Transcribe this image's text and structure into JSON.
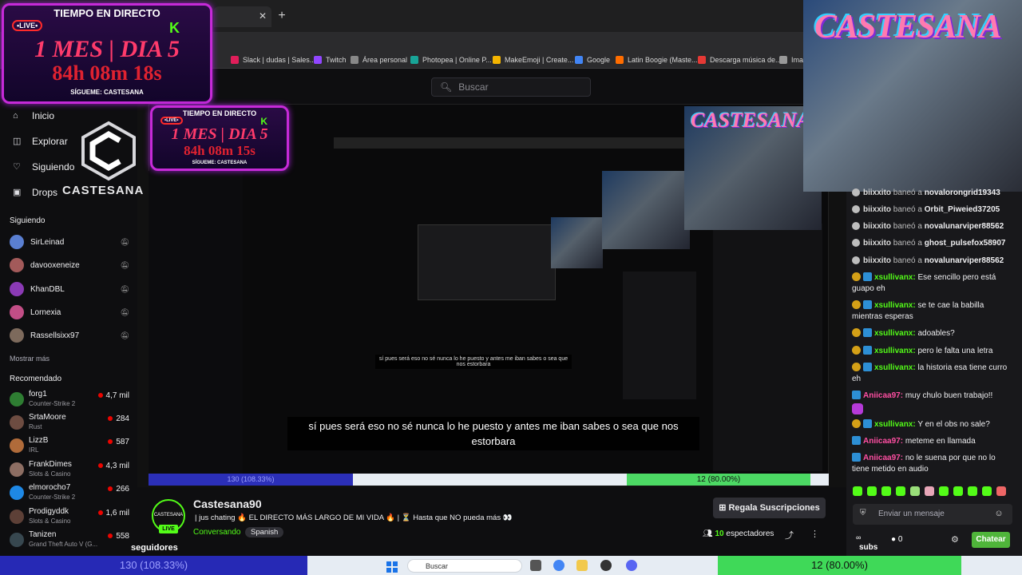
{
  "browser": {
    "bookmarks": [
      {
        "label": "Slack | dudas | Sales...",
        "color": "#e01e5a"
      },
      {
        "label": "Twitch",
        "color": "#9146ff"
      },
      {
        "label": "Área personal",
        "color": "#888888"
      },
      {
        "label": "Photopea | Online P...",
        "color": "#18a497"
      },
      {
        "label": "MakeEmoji | Create...",
        "color": "#f4b400"
      },
      {
        "label": "Google",
        "color": "#4285f4"
      },
      {
        "label": "Latin Boogie (Maste...",
        "color": "#ff6d00"
      },
      {
        "label": "Descarga música de...",
        "color": "#e53935"
      },
      {
        "label": "Imag",
        "color": "#999999"
      }
    ]
  },
  "header": {
    "search_placeholder": "Buscar"
  },
  "sidebar": {
    "nav": [
      {
        "label": "Inicio",
        "icon": "home-icon"
      },
      {
        "label": "Explorar",
        "icon": "explore-icon"
      },
      {
        "label": "Siguiendo",
        "icon": "heart-icon"
      },
      {
        "label": "Drops",
        "icon": "drops-icon"
      }
    ],
    "following_title": "Siguiendo",
    "following": [
      {
        "name": "SirLeinad",
        "color": "#5a7fd1"
      },
      {
        "name": "davooxeneize",
        "color": "#a35a5a"
      },
      {
        "name": "KhanDBL",
        "color": "#8b3ab5"
      },
      {
        "name": "Lornexia",
        "color": "#c24e86"
      },
      {
        "name": "Rassellsixx97",
        "color": "#7d6a5c"
      }
    ],
    "show_more": "Mostrar más",
    "recommended_title": "Recomendado",
    "recommended": [
      {
        "name": "forg1",
        "game": "Counter-Strike 2",
        "viewers": "4,7 mil",
        "color": "#2e7d32"
      },
      {
        "name": "SrtaMoore",
        "game": "Rust",
        "viewers": "284",
        "color": "#6d4c41"
      },
      {
        "name": "LizzB",
        "game": "IRL",
        "viewers": "587",
        "color": "#b06b3a"
      },
      {
        "name": "FrankDimes",
        "game": "Slots & Casino",
        "viewers": "4,3 mil",
        "color": "#8d6e63"
      },
      {
        "name": "elmorocho7",
        "game": "Counter-Strike 2",
        "viewers": "266",
        "color": "#1e88e5"
      },
      {
        "name": "Prodigyddk",
        "game": "Slots & Casino",
        "viewers": "1,6 mil",
        "color": "#5d4037"
      },
      {
        "name": "Tanizen",
        "game": "Grand Theft Auto V (G...",
        "viewers": "558",
        "color": "#37474f"
      }
    ]
  },
  "overlay": {
    "timer_header": "TIEMPO EN DIRECTO",
    "live": "•LIVE•",
    "timer_big": "1 MES | DIA 5",
    "timer_time": "84h 08m 18s",
    "timer_time_small": "84h 08m 15s",
    "timer_foot": "SÍGUEME: CASTESANA",
    "k_logo": "K",
    "logo_text": "CASTESANA",
    "cam_title": "CASTESANA"
  },
  "subtitle": "sí pues será eso no sé nunca lo he puesto y antes me iban sabes o sea que nos estorbara",
  "channel": {
    "name": "Castesana90",
    "avatar_text": "CASTESANA",
    "live": "LIVE",
    "title": "| jus chating 🔥 EL DIRECTO MÁS LARGO DE MI VIDA 🔥 | ⏳ Hasta que NO pueda más 👀",
    "category": "Conversando",
    "language": "Spanish",
    "followers": "seguidores",
    "gift_button": "Regala Suscripciones",
    "viewers_count": "10",
    "viewers_label": "espectadores"
  },
  "chat": {
    "messages": [
      {
        "type": "ban",
        "user": "biixxito",
        "text": "baneó a",
        "target": "novalorongrid19343"
      },
      {
        "type": "ban",
        "user": "biixxito",
        "text": "baneó a",
        "target": "Orbit_Piweied37205"
      },
      {
        "type": "ban",
        "user": "biixxito",
        "text": "baneó a",
        "target": "novalunarviper88562"
      },
      {
        "type": "ban",
        "user": "biixxito",
        "text": "baneó a",
        "target": "ghost_pulsefox58907"
      },
      {
        "type": "ban",
        "user": "biixxito",
        "text": "baneó a",
        "target": "novalunarviper88562"
      },
      {
        "type": "msg",
        "user": "xsullivanx:",
        "text": "Ese sencillo pero está guapo eh",
        "color": "#53fc18"
      },
      {
        "type": "msg",
        "user": "xsullivanx:",
        "text": "se te cae la babilla mientras esperas",
        "color": "#53fc18"
      },
      {
        "type": "msg",
        "user": "xsullivanx:",
        "text": "adoables?",
        "color": "#53fc18"
      },
      {
        "type": "msg",
        "user": "xsullivanx:",
        "text": "pero le falta una letra",
        "color": "#53fc18"
      },
      {
        "type": "msg",
        "user": "xsullivanx:",
        "text": "la historia esa tiene curro eh",
        "color": "#53fc18"
      },
      {
        "type": "msg",
        "user": "Aniicaa97:",
        "text": "muy chulo buen trabajo!!",
        "color": "#ff4fa3"
      },
      {
        "type": "msg",
        "user": "xsullivanx:",
        "text": "Y en el obs no sale?",
        "color": "#53fc18"
      },
      {
        "type": "msg",
        "user": "Aniicaa97:",
        "text": "meteme en llamada",
        "color": "#ff4fa3"
      },
      {
        "type": "msg",
        "user": "Aniicaa97:",
        "text": "no le suena por que no lo tiene metido en audio",
        "color": "#ff4fa3"
      }
    ],
    "input_placeholder": "Enviar un mensaje",
    "subs_icon": "∞",
    "subs_label": "subs",
    "points": "0",
    "chat_button": "Chatear"
  },
  "stream_bars": {
    "left": "130 (108.33%)",
    "left_small": "130 (108.33%)",
    "right": "12 (80.00%)"
  },
  "taskbar": {
    "search": "Buscar"
  },
  "colors": {
    "accent": "#53fc18",
    "timer_border": "#c62ad8",
    "bar_left": "#2629b5",
    "bar_right": "#3fd958"
  }
}
